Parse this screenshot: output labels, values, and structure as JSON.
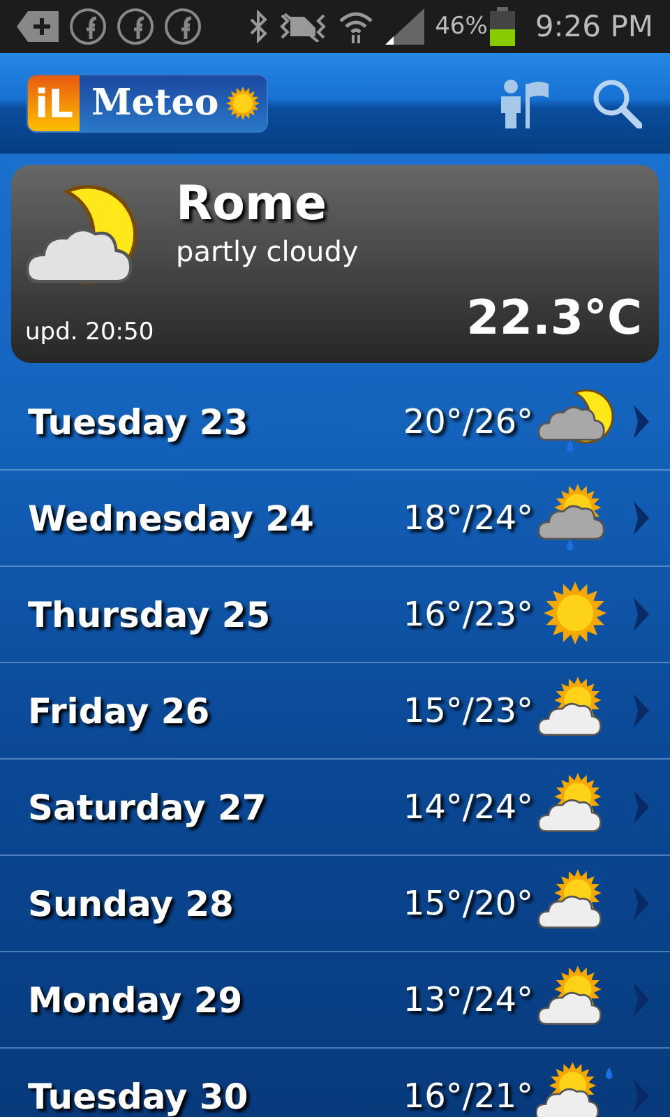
{
  "status_bar": {
    "battery_text": "46%",
    "time": "9:26 PM"
  },
  "header": {
    "logo_badge": "iL",
    "logo_word": "Meteo"
  },
  "current": {
    "city": "Rome",
    "condition": "partly cloudy",
    "updated": "upd. 20:50",
    "temperature": "22.3°C",
    "kind": "moon_cloud"
  },
  "days": [
    {
      "day": "Tuesday 23",
      "temps": "20°/26°",
      "kind": "moon_rain"
    },
    {
      "day": "Wednesday 24",
      "temps": "18°/24°",
      "kind": "sun_rain"
    },
    {
      "day": "Thursday 25",
      "temps": "16°/23°",
      "kind": "sun"
    },
    {
      "day": "Friday 26",
      "temps": "15°/23°",
      "kind": "sun_cloud"
    },
    {
      "day": "Saturday 27",
      "temps": "14°/24°",
      "kind": "sun_cloud"
    },
    {
      "day": "Sunday 28",
      "temps": "15°/20°",
      "kind": "sun_cloud"
    },
    {
      "day": "Monday 29",
      "temps": "13°/24°",
      "kind": "sun_cloud"
    },
    {
      "day": "Tuesday 30",
      "temps": "16°/21°",
      "kind": "sun_cloud_drop"
    }
  ]
}
